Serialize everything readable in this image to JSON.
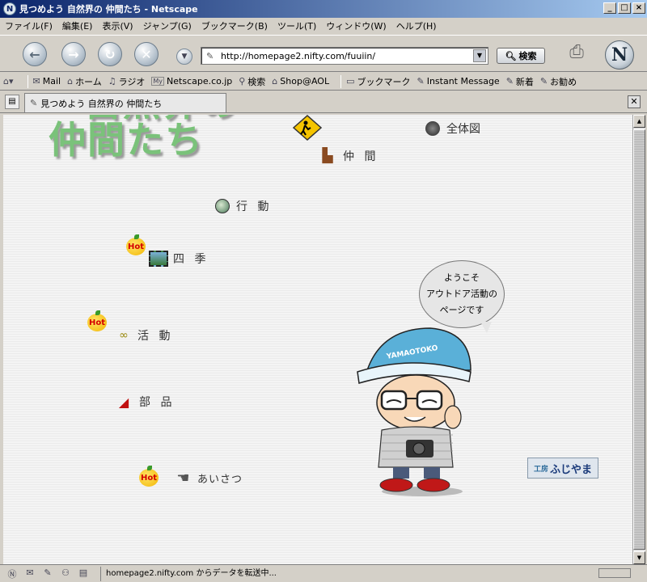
{
  "window": {
    "title": "見つめよう 自然界の 仲間たち - Netscape",
    "controls": {
      "minimize": "_",
      "maximize": "□",
      "close": "×"
    }
  },
  "menu": [
    "ファイル(F)",
    "編集(E)",
    "表示(V)",
    "ジャンプ(G)",
    "ブックマーク(B)",
    "ツール(T)",
    "ウィンドウ(W)",
    "ヘルプ(H)"
  ],
  "toolbar": {
    "url": "http://homepage2.nifty.com/fuuiin/",
    "search_label": "検索"
  },
  "personal_toolbar": {
    "items": [
      {
        "label": "Mail",
        "icon": "mail-icon"
      },
      {
        "label": "ホーム",
        "icon": "home-icon"
      },
      {
        "label": "ラジオ",
        "icon": "radio-icon"
      },
      {
        "label": "Netscape.co.jp",
        "icon": "my-icon"
      },
      {
        "label": "検索",
        "icon": "search-icon"
      },
      {
        "label": "Shop@AOL",
        "icon": "shop-icon"
      },
      {
        "label": "ブックマーク",
        "icon": "bookmark-icon"
      },
      {
        "label": "Instant Message",
        "icon": "link-icon"
      },
      {
        "label": "新着",
        "icon": "link-icon"
      },
      {
        "label": "お勧め",
        "icon": "link-icon"
      }
    ]
  },
  "tab": {
    "title": "見つめよう 自然界の 仲間たち"
  },
  "page": {
    "logo_line1": "自然界の",
    "logo_line2": "仲間たち",
    "overview_label": "全体図",
    "nav": [
      {
        "label": "仲 間",
        "icon": "boot-icon"
      },
      {
        "label": "行 動",
        "icon": "compass-icon"
      },
      {
        "label": "四 季",
        "icon": "film-icon",
        "hot": true
      },
      {
        "label": "活 動",
        "icon": "binoculars-icon",
        "hot": true
      },
      {
        "label": "部 品",
        "icon": "knife-icon"
      },
      {
        "label": "あいさつ",
        "icon": "hand-icon",
        "hot": true
      }
    ],
    "hot_label": "Hot",
    "bubble": [
      "ようこそ",
      "アウトドア活動の",
      "ページです"
    ],
    "cap_text": "YAMAOTOKO",
    "banner_small": "工房",
    "banner_main": "ふじやま"
  },
  "status": {
    "text": "homepage2.nifty.com からデータを転送中..."
  }
}
